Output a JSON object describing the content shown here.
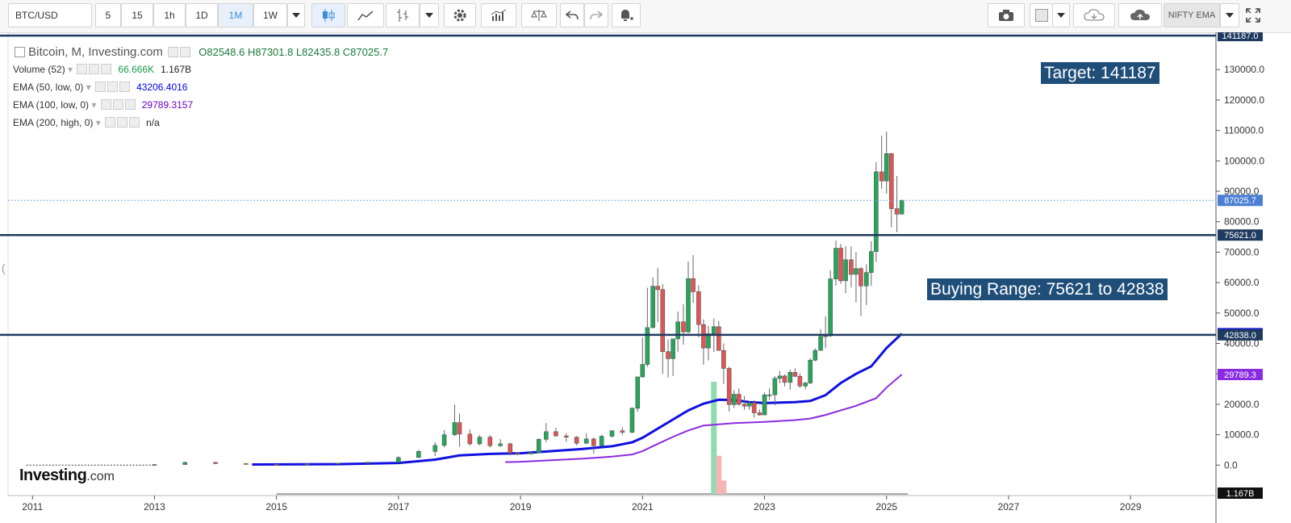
{
  "toolbar": {
    "symbol": "BTC/USD",
    "intervals": [
      "5",
      "15",
      "1h",
      "1D",
      "1M",
      "1W"
    ],
    "active_interval": "1M",
    "ema_button": "NIFTY EMA",
    "icons": [
      "chevron-down-icon",
      "candlestick-icon",
      "line-chart-icon",
      "bar-chart-icon",
      "chevron-down-icon",
      "gear-icon",
      "indicators-icon",
      "compare-icon",
      "undo-icon",
      "redo-icon",
      "alert-icon",
      "camera-icon",
      "color-box-icon",
      "chevron-down-icon",
      "cloud-download-icon",
      "cloud-upload-icon",
      "chevron-down-icon",
      "fullscreen-icon"
    ]
  },
  "legend": {
    "title": "Bitcoin, M, Investing.com",
    "ohlc": "O82548.6  H87301.8  L82435.8  C87025.7",
    "rows": [
      {
        "name": "Volume (52)",
        "values": [
          "66.666K",
          "1.167B"
        ],
        "colors": [
          "#1a9a4a",
          "#222222"
        ]
      },
      {
        "name": "EMA (50, low, 0)",
        "values": [
          "43206.4016"
        ],
        "colors": [
          "#0000ee"
        ]
      },
      {
        "name": "EMA (100, low, 0)",
        "values": [
          "29789.3157"
        ],
        "colors": [
          "#6a00cc"
        ]
      },
      {
        "name": "EMA (200, high, 0)",
        "values": [
          "n/a"
        ],
        "colors": [
          "#222222"
        ]
      }
    ]
  },
  "annotations": {
    "target": "Target: 141187",
    "buying_range": "Buying Range: 75621 to 42838"
  },
  "logo": {
    "main": "Investing",
    "suffix": ".com"
  },
  "colors": {
    "up": "#26a65b",
    "down": "#e05555",
    "ema50": "#1010e0",
    "ema100": "#8a2be2",
    "hline": "#1f3a5f",
    "label_bg": "#1f3a5f"
  },
  "chart_data": {
    "type": "candlestick",
    "title": "Bitcoin, M, Investing.com",
    "x_ticks": [
      "2011",
      "2013",
      "2015",
      "2017",
      "2019",
      "2021",
      "2023",
      "2025",
      "2027",
      "2029"
    ],
    "y_ticks": [
      0,
      10000,
      20000,
      30000,
      40000,
      50000,
      60000,
      70000,
      80000,
      90000,
      100000,
      110000,
      120000,
      130000
    ],
    "ylim": [
      -10000,
      142000
    ],
    "xlim": [
      2010.6,
      2030.4
    ],
    "horizontal_lines": [
      141187.0,
      75621.0,
      42838.0
    ],
    "price_labels": [
      {
        "value": 141187.0,
        "text": "141187.0",
        "color": "#1f3a5f"
      },
      {
        "value": 87025.7,
        "text": "87025.7",
        "color": "#4a7fd4"
      },
      {
        "value": 75621.0,
        "text": "75621.0",
        "color": "#1f3a5f"
      },
      {
        "value": 43206.4,
        "text": "43206.4",
        "color": "#1010e0"
      },
      {
        "value": 42838.0,
        "text": "42838.0",
        "color": "#1f3a5f"
      },
      {
        "value": 29789.3,
        "text": "29789.3",
        "color": "#8a2be2"
      }
    ],
    "volume_label": "1.167B",
    "current_price": 87025.7,
    "candles": [
      {
        "t": 2013.0,
        "o": 100,
        "h": 260,
        "l": 80,
        "c": 200
      },
      {
        "t": 2013.5,
        "o": 200,
        "h": 1150,
        "l": 150,
        "c": 900
      },
      {
        "t": 2014.0,
        "o": 900,
        "h": 1100,
        "l": 400,
        "c": 500
      },
      {
        "t": 2014.5,
        "o": 500,
        "h": 700,
        "l": 300,
        "c": 350
      },
      {
        "t": 2015.0,
        "o": 320,
        "h": 450,
        "l": 200,
        "c": 260
      },
      {
        "t": 2015.5,
        "o": 260,
        "h": 480,
        "l": 220,
        "c": 430
      },
      {
        "t": 2016.0,
        "o": 430,
        "h": 700,
        "l": 380,
        "c": 650
      },
      {
        "t": 2016.5,
        "o": 650,
        "h": 1000,
        "l": 500,
        "c": 960
      },
      {
        "t": 2017.0,
        "o": 960,
        "h": 2900,
        "l": 900,
        "c": 2500
      },
      {
        "t": 2017.33,
        "o": 2500,
        "h": 5000,
        "l": 2400,
        "c": 4500
      },
      {
        "t": 2017.6,
        "o": 4500,
        "h": 7500,
        "l": 3000,
        "c": 6500
      },
      {
        "t": 2017.75,
        "o": 6500,
        "h": 11500,
        "l": 5800,
        "c": 10000
      },
      {
        "t": 2017.92,
        "o": 10000,
        "h": 19900,
        "l": 9500,
        "c": 14000
      },
      {
        "t": 2018.0,
        "o": 14000,
        "h": 17000,
        "l": 6000,
        "c": 10200
      },
      {
        "t": 2018.17,
        "o": 10200,
        "h": 11700,
        "l": 6400,
        "c": 7000
      },
      {
        "t": 2018.33,
        "o": 7000,
        "h": 9900,
        "l": 6500,
        "c": 9200
      },
      {
        "t": 2018.5,
        "o": 9200,
        "h": 9900,
        "l": 5800,
        "c": 6400
      },
      {
        "t": 2018.67,
        "o": 6400,
        "h": 8500,
        "l": 5900,
        "c": 7000
      },
      {
        "t": 2018.83,
        "o": 7000,
        "h": 7400,
        "l": 3200,
        "c": 4000
      },
      {
        "t": 2018.95,
        "o": 4000,
        "h": 4300,
        "l": 3200,
        "c": 3700
      },
      {
        "t": 2019.17,
        "o": 3700,
        "h": 4200,
        "l": 3400,
        "c": 4100
      },
      {
        "t": 2019.3,
        "o": 4100,
        "h": 8800,
        "l": 4000,
        "c": 8500
      },
      {
        "t": 2019.42,
        "o": 8500,
        "h": 13800,
        "l": 7500,
        "c": 11000
      },
      {
        "t": 2019.58,
        "o": 11000,
        "h": 12300,
        "l": 9400,
        "c": 9600
      },
      {
        "t": 2019.75,
        "o": 9600,
        "h": 10500,
        "l": 7700,
        "c": 9200
      },
      {
        "t": 2019.92,
        "o": 9200,
        "h": 9500,
        "l": 6500,
        "c": 7200
      },
      {
        "t": 2020.08,
        "o": 7200,
        "h": 10500,
        "l": 6900,
        "c": 8600
      },
      {
        "t": 2020.2,
        "o": 8600,
        "h": 9100,
        "l": 3800,
        "c": 6400
      },
      {
        "t": 2020.33,
        "o": 6400,
        "h": 10000,
        "l": 6200,
        "c": 9500
      },
      {
        "t": 2020.5,
        "o": 9500,
        "h": 11500,
        "l": 9000,
        "c": 11300
      },
      {
        "t": 2020.67,
        "o": 11300,
        "h": 12400,
        "l": 10000,
        "c": 10800
      },
      {
        "t": 2020.83,
        "o": 10800,
        "h": 19000,
        "l": 10500,
        "c": 18700
      },
      {
        "t": 2020.92,
        "o": 18700,
        "h": 29000,
        "l": 17500,
        "c": 29000
      },
      {
        "t": 2021.0,
        "o": 29000,
        "h": 41900,
        "l": 28800,
        "c": 33100
      },
      {
        "t": 2021.08,
        "o": 33100,
        "h": 58300,
        "l": 32300,
        "c": 45200
      },
      {
        "t": 2021.17,
        "o": 45200,
        "h": 61700,
        "l": 45000,
        "c": 58800
      },
      {
        "t": 2021.25,
        "o": 58800,
        "h": 64800,
        "l": 47000,
        "c": 57700
      },
      {
        "t": 2021.33,
        "o": 57700,
        "h": 59500,
        "l": 30000,
        "c": 37300
      },
      {
        "t": 2021.42,
        "o": 37300,
        "h": 41300,
        "l": 28800,
        "c": 35000
      },
      {
        "t": 2021.5,
        "o": 35000,
        "h": 41300,
        "l": 29300,
        "c": 41500
      },
      {
        "t": 2021.58,
        "o": 41500,
        "h": 50500,
        "l": 37300,
        "c": 47100
      },
      {
        "t": 2021.67,
        "o": 47100,
        "h": 52900,
        "l": 39600,
        "c": 43800
      },
      {
        "t": 2021.75,
        "o": 43800,
        "h": 66900,
        "l": 43300,
        "c": 61300
      },
      {
        "t": 2021.83,
        "o": 61300,
        "h": 69000,
        "l": 53300,
        "c": 57000
      },
      {
        "t": 2021.92,
        "o": 57000,
        "h": 59100,
        "l": 42000,
        "c": 46200
      },
      {
        "t": 2022.0,
        "o": 46200,
        "h": 47900,
        "l": 33000,
        "c": 38500
      },
      {
        "t": 2022.08,
        "o": 38500,
        "h": 45800,
        "l": 34400,
        "c": 43200
      },
      {
        "t": 2022.17,
        "o": 43200,
        "h": 48200,
        "l": 37200,
        "c": 45500
      },
      {
        "t": 2022.25,
        "o": 45500,
        "h": 47400,
        "l": 37600,
        "c": 37700
      },
      {
        "t": 2022.33,
        "o": 37700,
        "h": 40000,
        "l": 26700,
        "c": 31800
      },
      {
        "t": 2022.42,
        "o": 31800,
        "h": 32400,
        "l": 17600,
        "c": 19900
      },
      {
        "t": 2022.5,
        "o": 19900,
        "h": 24600,
        "l": 18800,
        "c": 23300
      },
      {
        "t": 2022.58,
        "o": 23300,
        "h": 25200,
        "l": 19600,
        "c": 20000
      },
      {
        "t": 2022.67,
        "o": 20000,
        "h": 22700,
        "l": 18200,
        "c": 19400
      },
      {
        "t": 2022.75,
        "o": 19400,
        "h": 20900,
        "l": 18200,
        "c": 20500
      },
      {
        "t": 2022.83,
        "o": 20500,
        "h": 21400,
        "l": 15600,
        "c": 17200
      },
      {
        "t": 2022.92,
        "o": 17200,
        "h": 18300,
        "l": 16300,
        "c": 16500
      },
      {
        "t": 2023.0,
        "o": 16500,
        "h": 23900,
        "l": 16500,
        "c": 23100
      },
      {
        "t": 2023.08,
        "o": 23100,
        "h": 25200,
        "l": 21400,
        "c": 23100
      },
      {
        "t": 2023.17,
        "o": 23100,
        "h": 29200,
        "l": 19600,
        "c": 28500
      },
      {
        "t": 2023.25,
        "o": 28500,
        "h": 31000,
        "l": 26900,
        "c": 29300
      },
      {
        "t": 2023.33,
        "o": 29300,
        "h": 29800,
        "l": 25900,
        "c": 27200
      },
      {
        "t": 2023.42,
        "o": 27200,
        "h": 31400,
        "l": 24800,
        "c": 30500
      },
      {
        "t": 2023.5,
        "o": 30500,
        "h": 31800,
        "l": 28900,
        "c": 29200
      },
      {
        "t": 2023.58,
        "o": 29200,
        "h": 30200,
        "l": 25400,
        "c": 26000
      },
      {
        "t": 2023.67,
        "o": 26000,
        "h": 27400,
        "l": 24900,
        "c": 27000
      },
      {
        "t": 2023.75,
        "o": 27000,
        "h": 35200,
        "l": 26600,
        "c": 34500
      },
      {
        "t": 2023.83,
        "o": 34500,
        "h": 38400,
        "l": 34100,
        "c": 37700
      },
      {
        "t": 2023.92,
        "o": 37700,
        "h": 44700,
        "l": 37600,
        "c": 42300
      },
      {
        "t": 2024.0,
        "o": 42300,
        "h": 48900,
        "l": 38500,
        "c": 42500
      },
      {
        "t": 2024.08,
        "o": 42500,
        "h": 64000,
        "l": 42100,
        "c": 61200
      },
      {
        "t": 2024.17,
        "o": 61200,
        "h": 73800,
        "l": 59000,
        "c": 71300
      },
      {
        "t": 2024.25,
        "o": 71300,
        "h": 72700,
        "l": 59600,
        "c": 60600
      },
      {
        "t": 2024.33,
        "o": 60600,
        "h": 71900,
        "l": 56500,
        "c": 67500
      },
      {
        "t": 2024.42,
        "o": 67500,
        "h": 71900,
        "l": 58400,
        "c": 62700
      },
      {
        "t": 2024.5,
        "o": 62700,
        "h": 70000,
        "l": 53500,
        "c": 64600
      },
      {
        "t": 2024.58,
        "o": 64600,
        "h": 65100,
        "l": 49100,
        "c": 58900
      },
      {
        "t": 2024.67,
        "o": 58900,
        "h": 66000,
        "l": 52600,
        "c": 63300
      },
      {
        "t": 2024.75,
        "o": 63300,
        "h": 73600,
        "l": 58900,
        "c": 70200
      },
      {
        "t": 2024.83,
        "o": 70200,
        "h": 99600,
        "l": 66800,
        "c": 96400
      },
      {
        "t": 2024.92,
        "o": 96400,
        "h": 108300,
        "l": 90800,
        "c": 93400
      },
      {
        "t": 2025.0,
        "o": 93400,
        "h": 109600,
        "l": 89200,
        "c": 102400
      },
      {
        "t": 2025.08,
        "o": 102400,
        "h": 102600,
        "l": 78200,
        "c": 84300
      },
      {
        "t": 2025.17,
        "o": 84300,
        "h": 95000,
        "l": 76600,
        "c": 82500
      },
      {
        "t": 2025.25,
        "o": 82500,
        "h": 87300,
        "l": 82400,
        "c": 87000
      }
    ],
    "flat_history": [
      {
        "t": 2010.9,
        "v": 0
      },
      {
        "t": 2013.0,
        "v": 0
      }
    ],
    "ema50": [
      {
        "t": 2014.6,
        "v": 200
      },
      {
        "t": 2016.0,
        "v": 300
      },
      {
        "t": 2017.0,
        "v": 700
      },
      {
        "t": 2017.6,
        "v": 1800
      },
      {
        "t": 2018.0,
        "v": 3200
      },
      {
        "t": 2018.5,
        "v": 3700
      },
      {
        "t": 2019.0,
        "v": 3900
      },
      {
        "t": 2019.5,
        "v": 4600
      },
      {
        "t": 2020.0,
        "v": 5300
      },
      {
        "t": 2020.5,
        "v": 6200
      },
      {
        "t": 2020.83,
        "v": 7500
      },
      {
        "t": 2021.0,
        "v": 9000
      },
      {
        "t": 2021.25,
        "v": 12000
      },
      {
        "t": 2021.5,
        "v": 15000
      },
      {
        "t": 2021.75,
        "v": 18000
      },
      {
        "t": 2022.0,
        "v": 20200
      },
      {
        "t": 2022.25,
        "v": 21500
      },
      {
        "t": 2022.5,
        "v": 21400
      },
      {
        "t": 2022.75,
        "v": 20700
      },
      {
        "t": 2023.0,
        "v": 20400
      },
      {
        "t": 2023.5,
        "v": 20700
      },
      {
        "t": 2023.75,
        "v": 21100
      },
      {
        "t": 2024.0,
        "v": 23000
      },
      {
        "t": 2024.25,
        "v": 27000
      },
      {
        "t": 2024.5,
        "v": 30000
      },
      {
        "t": 2024.75,
        "v": 32500
      },
      {
        "t": 2025.0,
        "v": 38500
      },
      {
        "t": 2025.25,
        "v": 43206.4
      }
    ],
    "ema100": [
      {
        "t": 2018.75,
        "v": 1000
      },
      {
        "t": 2019.0,
        "v": 1100
      },
      {
        "t": 2019.5,
        "v": 1600
      },
      {
        "t": 2020.0,
        "v": 2100
      },
      {
        "t": 2020.5,
        "v": 2800
      },
      {
        "t": 2020.83,
        "v": 3500
      },
      {
        "t": 2021.0,
        "v": 4600
      },
      {
        "t": 2021.25,
        "v": 7000
      },
      {
        "t": 2021.5,
        "v": 9300
      },
      {
        "t": 2021.75,
        "v": 11400
      },
      {
        "t": 2022.0,
        "v": 13000
      },
      {
        "t": 2022.5,
        "v": 13800
      },
      {
        "t": 2023.0,
        "v": 14200
      },
      {
        "t": 2023.5,
        "v": 14800
      },
      {
        "t": 2023.75,
        "v": 15300
      },
      {
        "t": 2024.0,
        "v": 16500
      },
      {
        "t": 2024.5,
        "v": 19500
      },
      {
        "t": 2024.83,
        "v": 22000
      },
      {
        "t": 2025.0,
        "v": 25500
      },
      {
        "t": 2025.25,
        "v": 29789.3
      }
    ],
    "volume": [
      {
        "t": 2022.17,
        "v": 1.0
      },
      {
        "t": 2022.25,
        "v": 0.34
      },
      {
        "t": 2022.33,
        "v": 0.12
      }
    ]
  }
}
